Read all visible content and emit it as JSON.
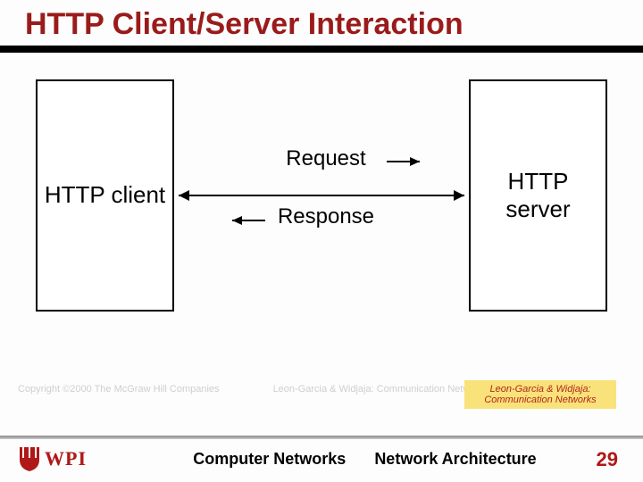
{
  "title": "HTTP Client/Server Interaction",
  "diagram": {
    "client_label": "HTTP client",
    "server_label": "HTTP server",
    "request_label": "Request",
    "response_label": "Response"
  },
  "copyright": {
    "left": "Copyright ©2000 The McGraw Hill Companies",
    "right": "Leon-Garcia & Widjaja: Communication Networks"
  },
  "attribution": "Leon-Garcia & Widjaja: Communication Networks",
  "footer": {
    "logo_text": "WPI",
    "course": "Computer Networks",
    "topic": "Network Architecture"
  },
  "page_number": "29",
  "colors": {
    "heading": "#9a1b1b",
    "accent": "#b01818",
    "highlight_bg": "#f9e27a"
  }
}
